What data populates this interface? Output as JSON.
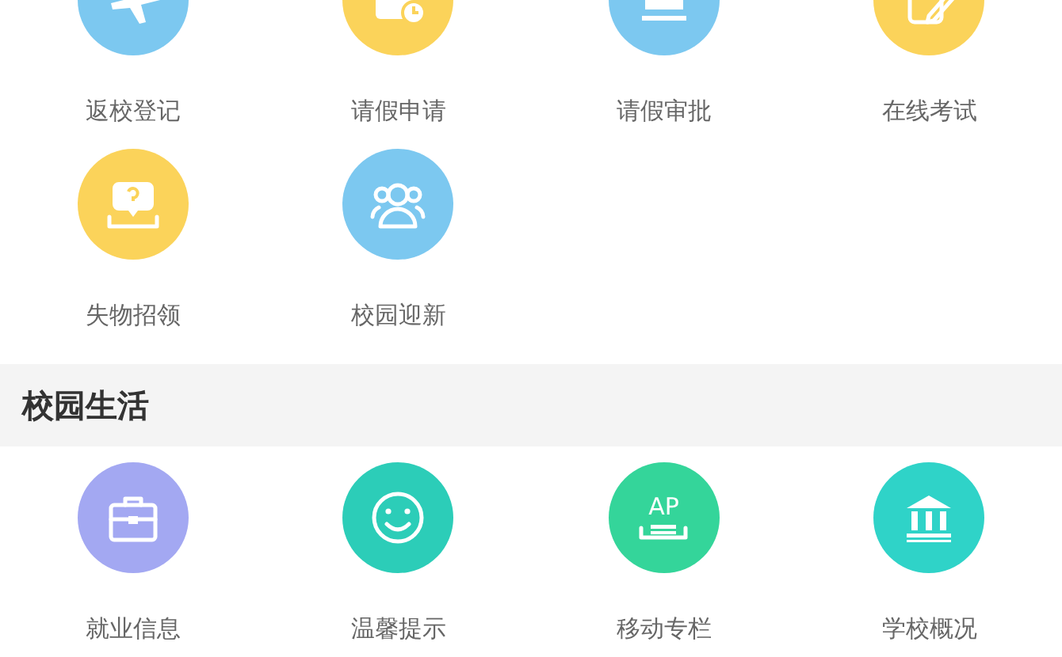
{
  "sections": [
    {
      "items": [
        {
          "label": "返校登记",
          "kind": "plane",
          "color": "#7cc8f0"
        },
        {
          "label": "请假申请",
          "kind": "calendar",
          "color": "#fbd35a"
        },
        {
          "label": "请假审批",
          "kind": "stamp",
          "color": "#7cc8f0"
        },
        {
          "label": "在线考试",
          "kind": "pencil",
          "color": "#fbd35a"
        },
        {
          "label": "失物招领",
          "kind": "question",
          "color": "#fbd35a"
        },
        {
          "label": "校园迎新",
          "kind": "people",
          "color": "#7cc8f0"
        }
      ]
    },
    {
      "title": "校园生活",
      "items": [
        {
          "label": "就业信息",
          "kind": "briefcase",
          "color": "#a3a8f2"
        },
        {
          "label": "温馨提示",
          "kind": "smile",
          "color": "#2ccdb8"
        },
        {
          "label": "移动专栏",
          "kind": "ad",
          "color": "#34d59a",
          "icon_text": "AP"
        },
        {
          "label": "学校概况",
          "kind": "bank",
          "color": "#2fd3c8"
        }
      ]
    }
  ]
}
